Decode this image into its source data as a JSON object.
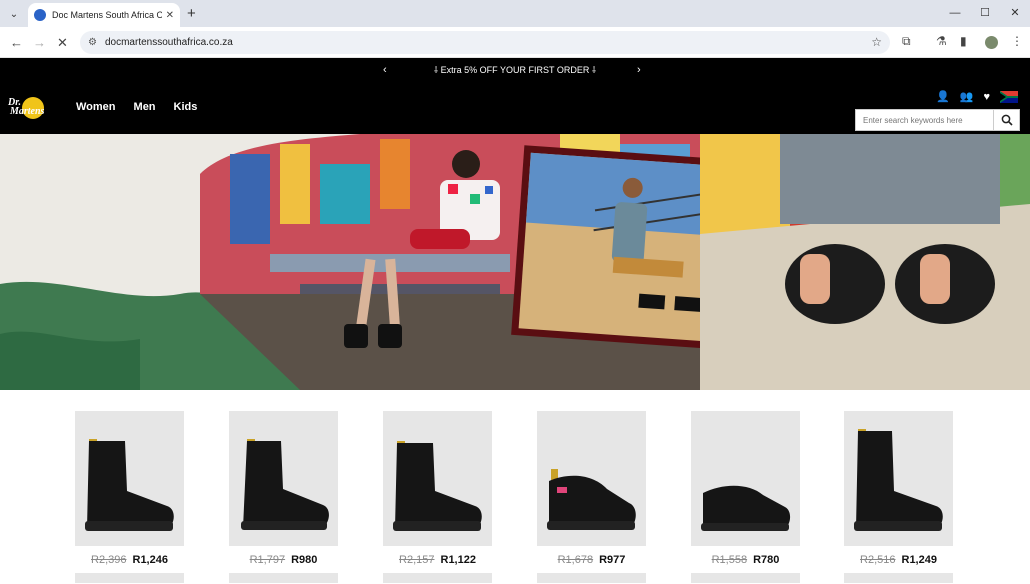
{
  "browser": {
    "tab_title": "Doc Martens South Africa Out",
    "url": "docmartenssouthafrica.co.za"
  },
  "promo": {
    "text": "Extra 5% OFF YOUR FIRST ORDER"
  },
  "nav": {
    "links": [
      "Women",
      "Men",
      "Kids"
    ]
  },
  "search": {
    "placeholder": "Enter search keywords here"
  },
  "products": [
    {
      "old": "R2,396",
      "new": "R1,246",
      "style": "boot"
    },
    {
      "old": "R1,797",
      "new": "R980",
      "style": "boot"
    },
    {
      "old": "R2,157",
      "new": "R1,122",
      "style": "boot"
    },
    {
      "old": "R1,678",
      "new": "R977",
      "style": "shoe-red"
    },
    {
      "old": "R1,558",
      "new": "R780",
      "style": "shoe"
    },
    {
      "old": "R2,516",
      "new": "R1,249",
      "style": "boot-tall"
    }
  ]
}
